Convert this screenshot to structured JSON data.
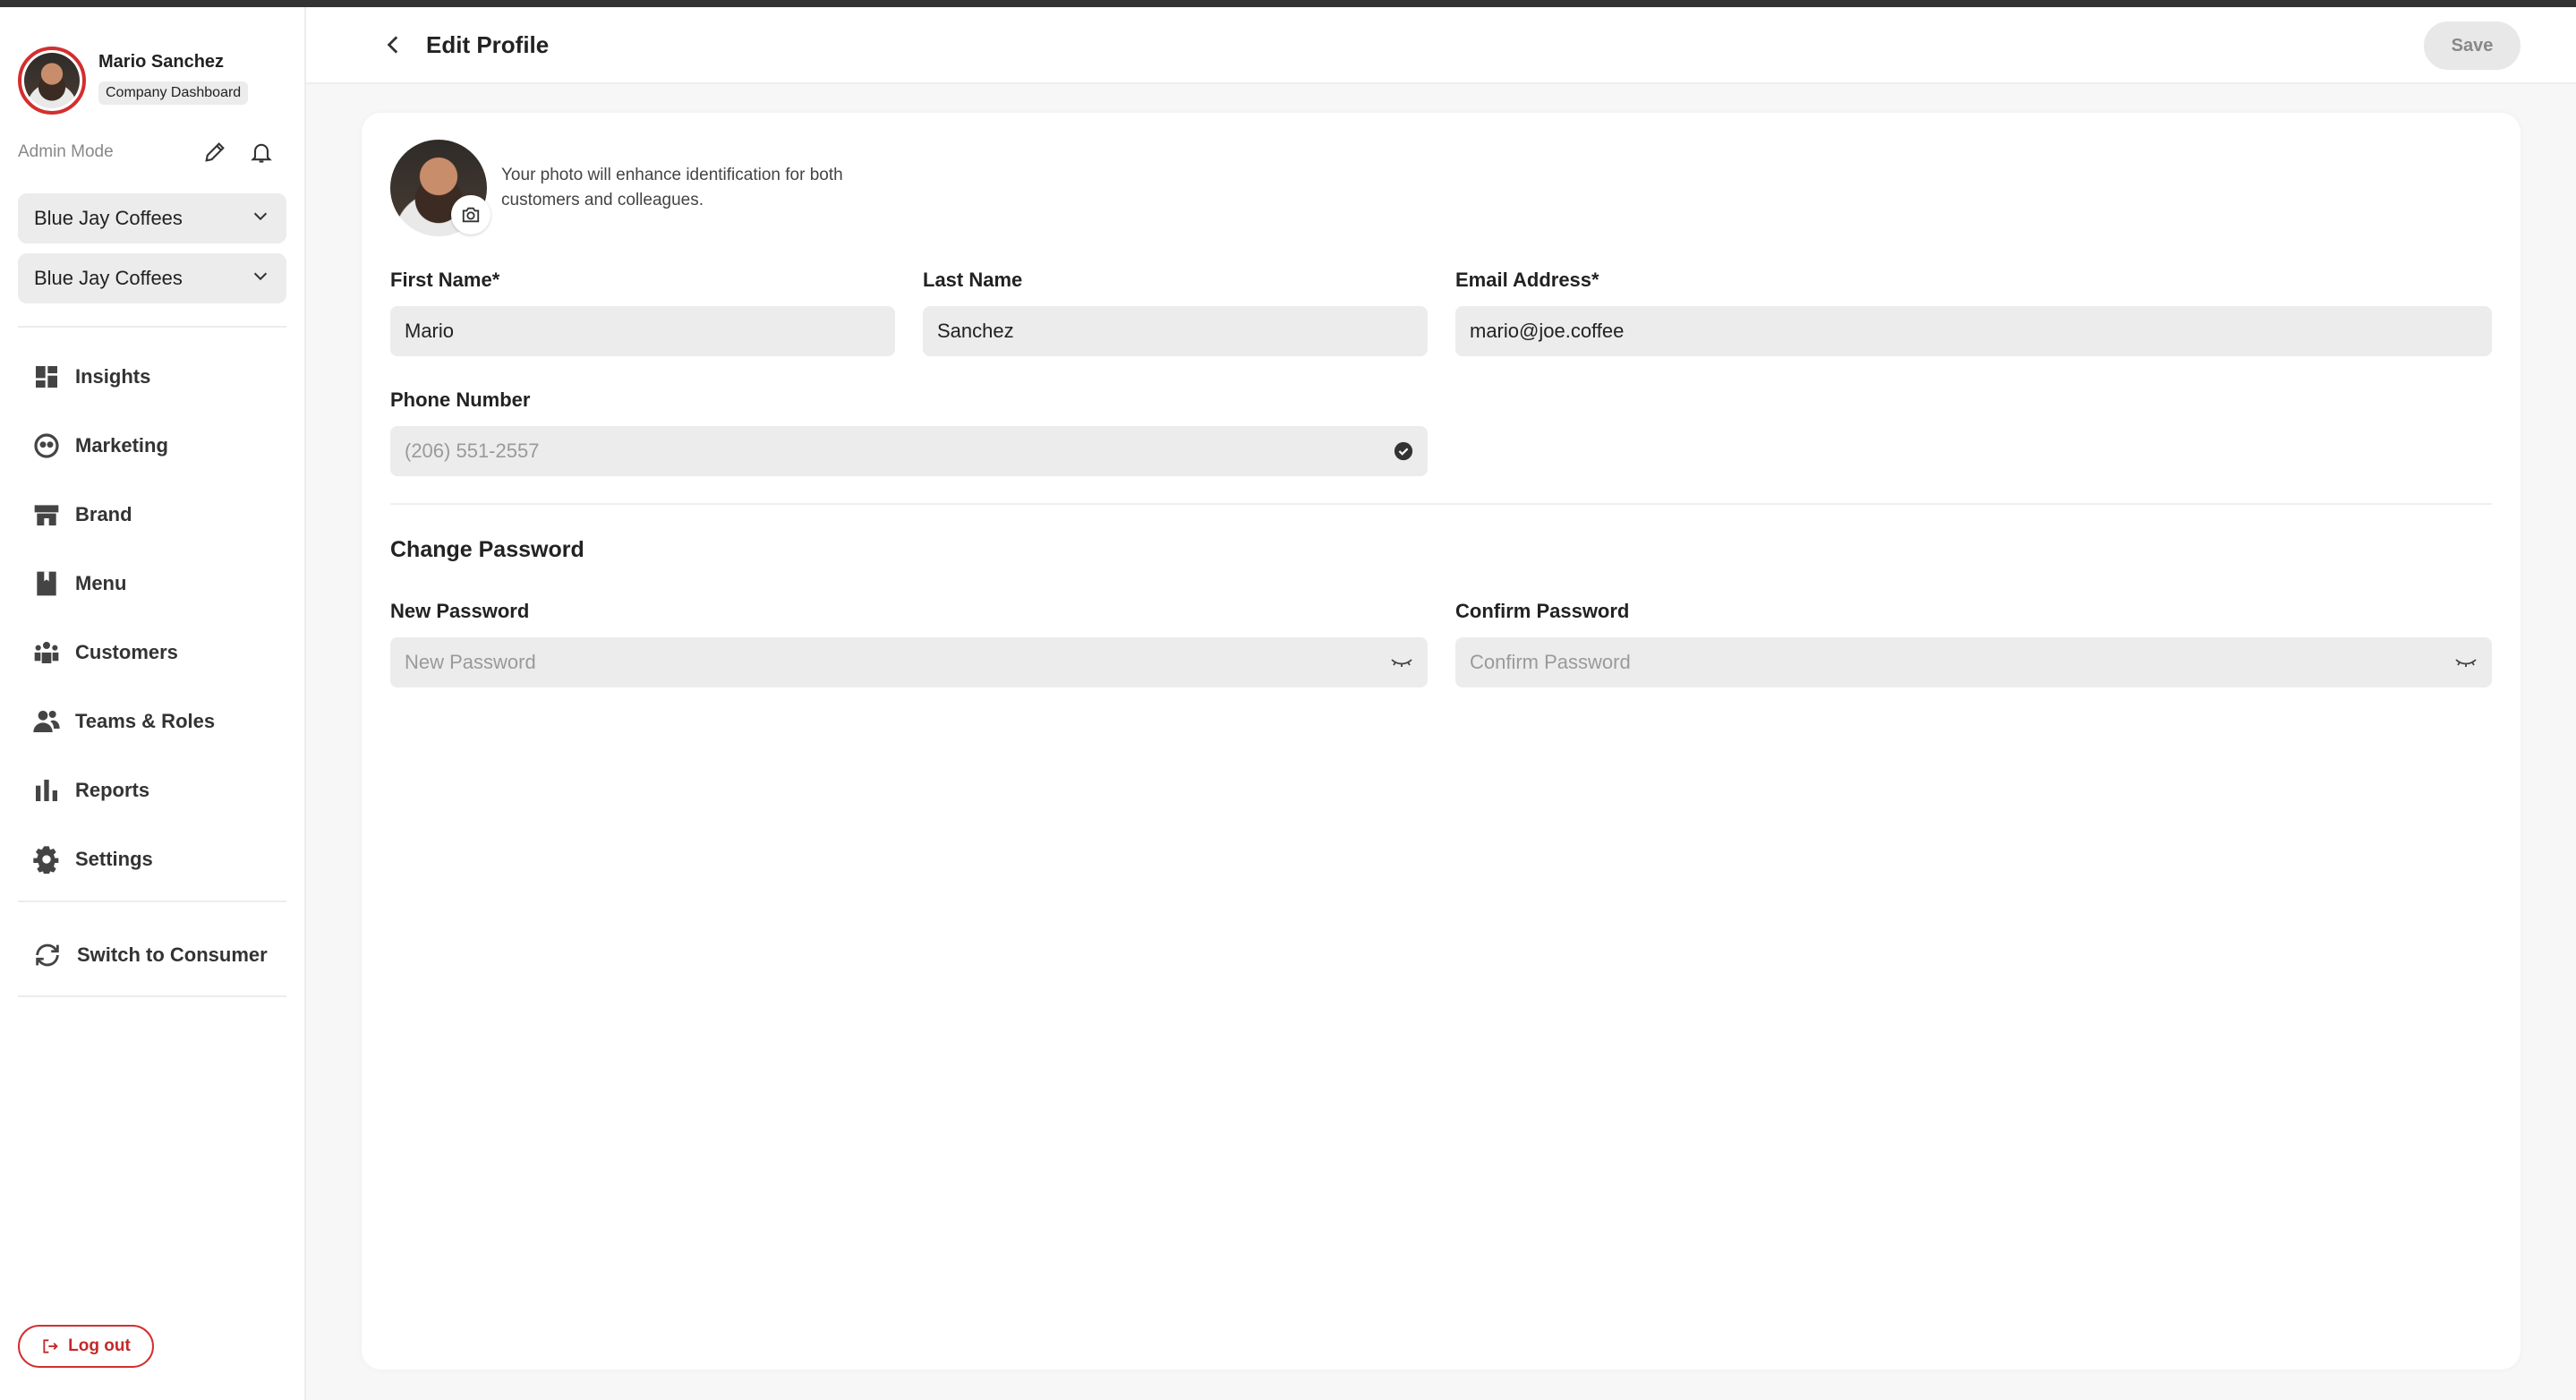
{
  "user": {
    "name": "Mario Sanchez",
    "badge": "Company Dashboard",
    "mode": "Admin Mode"
  },
  "selectors": [
    {
      "value": "Blue Jay Coffees"
    },
    {
      "value": "Blue Jay Coffees"
    }
  ],
  "nav": [
    {
      "label": "Insights",
      "icon": "grid-icon"
    },
    {
      "label": "Marketing",
      "icon": "megaphone-icon"
    },
    {
      "label": "Brand",
      "icon": "storefront-icon"
    },
    {
      "label": "Menu",
      "icon": "book-icon"
    },
    {
      "label": "Customers",
      "icon": "people-icon"
    },
    {
      "label": "Teams & Roles",
      "icon": "team-icon"
    },
    {
      "label": "Reports",
      "icon": "bar-chart-icon"
    },
    {
      "label": "Settings",
      "icon": "gear-icon"
    }
  ],
  "switch_label": "Switch to Consumer",
  "logout_label": "Log out",
  "header": {
    "title": "Edit Profile",
    "save_label": "Save"
  },
  "profile": {
    "photo_hint": "Your photo will enhance identification for both customers and colleagues.",
    "first_name": {
      "label": "First Name",
      "required": "*",
      "value": "Mario"
    },
    "last_name": {
      "label": "Last Name",
      "value": "Sanchez"
    },
    "email": {
      "label": "Email Address",
      "required": "*",
      "value": "mario@joe.coffee"
    },
    "phone": {
      "label": "Phone Number",
      "placeholder": "(206) 551-2557"
    }
  },
  "password": {
    "title": "Change Password",
    "new": {
      "label": "New Password",
      "placeholder": "New Password"
    },
    "confirm": {
      "label": "Confirm Password",
      "placeholder": "Confirm Password"
    }
  },
  "colors": {
    "accent": "#d32f2f",
    "field_bg": "#ececec"
  }
}
